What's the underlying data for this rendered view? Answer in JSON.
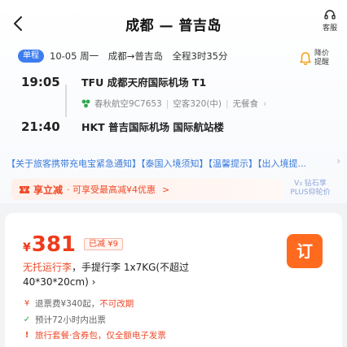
{
  "header": {
    "title": "成都 — 普吉岛",
    "service_label": "客服"
  },
  "summary": {
    "trip_tag": "单程",
    "date": "10-05 周一",
    "route": "成都→普吉岛",
    "duration": "全程3时35分",
    "notify_label": "降价提醒"
  },
  "segment": {
    "depart_time": "19:05",
    "depart_airport": "TFU 成都天府国际机场 T1",
    "airline": "春秋航空9C7653",
    "aircraft": "空客320(中)",
    "meal": "无餐食",
    "arrive_time": "21:40",
    "arrive_airport": "HKT 普吉国际机场 国际航站楼"
  },
  "notice": {
    "text": "【关于旅客携带充电宝紧急通知】【泰国入境须知】【温馨提示】【出入境提..."
  },
  "promo": {
    "title": "享立减",
    "desc": "· 可享受最高减¥4优惠",
    "arrow": ">",
    "tier_line1": "V₃ 钻石享",
    "tier_line2": "PLUS仰轮价"
  },
  "fare": {
    "price_symbol": "¥",
    "price": "381",
    "discount": "已减 ¥9",
    "book_label": "订",
    "baggage_warn": "无托运行李",
    "baggage_rest": "，手提行李 1x7KG(不超过40*30*20cm) ›",
    "refund_prefix": "退票费¥340起，",
    "refund_warn": "不可改期",
    "ticketing": "预计72小时内出票",
    "package": "旅行套餐·含券包，仅全额电子发票"
  },
  "colors": {
    "accent_red": "#ee3b1c",
    "book_orange": "#ff6a1f",
    "link_blue": "#3b7cdb",
    "tag_blue": "#3e7df0"
  }
}
